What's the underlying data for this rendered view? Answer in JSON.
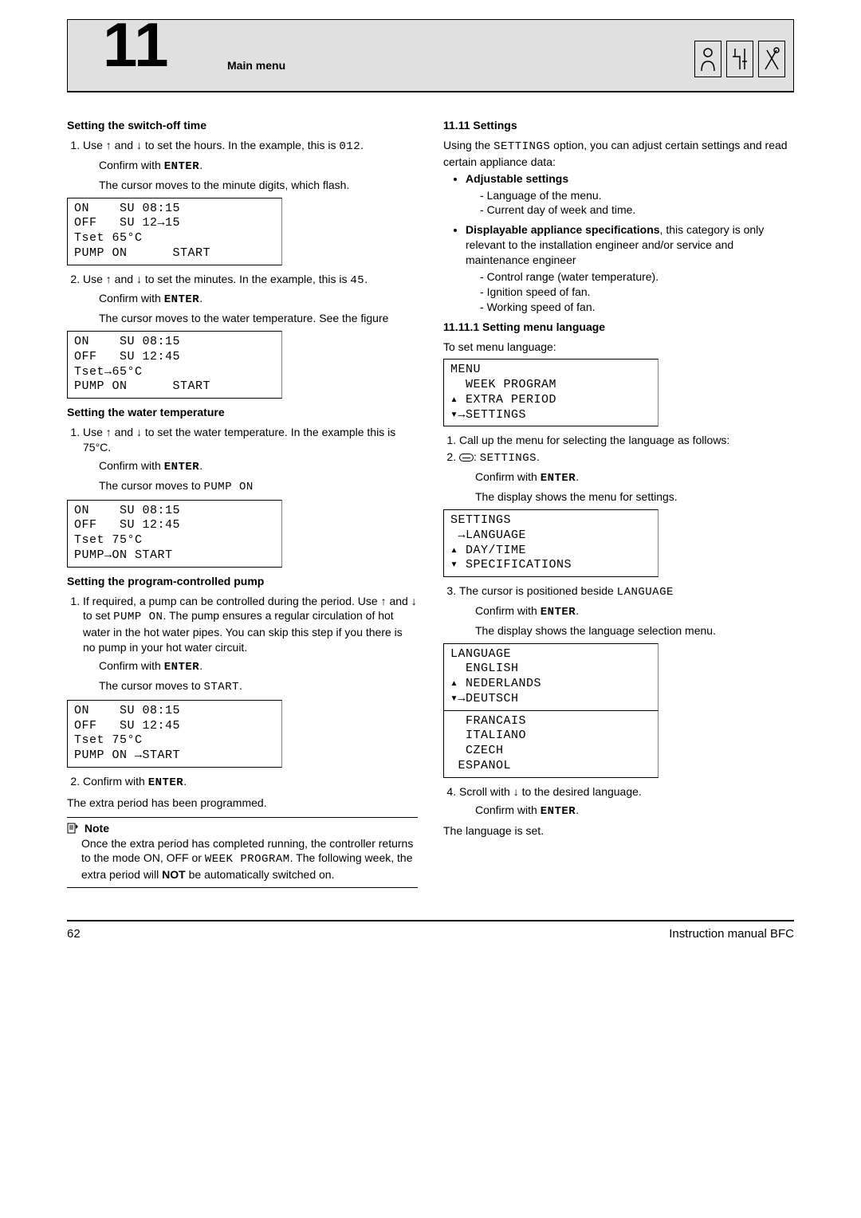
{
  "header": {
    "chapter_number": "11",
    "chapter_title": "Main menu"
  },
  "left": {
    "h_switchoff": "Setting the switch-off time",
    "step1": {
      "num": "1.",
      "text_a": "Use ",
      "text_b": " and ",
      "text_c": " to set the hours. In the example, this is ",
      "val": "012",
      "text_d": ".",
      "confirm": "Confirm with ",
      "enter": "ENTER",
      "confirm_end": ".",
      "cursor": "The cursor moves to the minute digits, which flash."
    },
    "lcd1": "ON    SU 08:15\nOFF   SU 12→15\nTset 65°C\nPUMP ON      START",
    "step2": {
      "num": "2.",
      "text_a": "Use ",
      "text_b": " and ",
      "text_c": " to set the minutes. In the example, this is ",
      "val": "45",
      "text_d": ".",
      "confirm": "Confirm with ",
      "enter": "ENTER",
      "confirm_end": ".",
      "cursor": "The cursor moves to the water temperature. See the figure"
    },
    "lcd2": "ON    SU 08:15\nOFF   SU 12:45\nTset→65°C\nPUMP ON      START",
    "h_watertemp": "Setting the water temperature",
    "wt_step": {
      "num": "1.",
      "text_a": "Use ",
      "text_b": " and ",
      "text_c": " to set the water temperature. In the example this is 75°C.",
      "confirm": "Confirm with ",
      "enter": "ENTER",
      "confirm_end": ".",
      "cursor_a": "The cursor moves to ",
      "cursor_b": "PUMP ON"
    },
    "lcd3": "ON    SU 08:15\nOFF   SU 12:45\nTset 75°C\nPUMP→ON START",
    "h_pump": "Setting the program-controlled pump",
    "pump_step1": {
      "num": "1.",
      "text_a": "If required, a pump can be controlled during the period. Use ",
      "text_b": " and ",
      "text_c": " to set ",
      "pump_on": "PUMP ON",
      "text_d": ". The pump ensures a regular circulation of hot water in the hot water pipes. You can skip this step if you there is no pump in your hot water circuit.",
      "confirm": "Confirm with ",
      "enter": "ENTER",
      "confirm_end": ".",
      "cursor_a": "The cursor moves to ",
      "cursor_b": "START",
      "cursor_c": "."
    },
    "lcd4": "ON    SU 08:15\nOFF   SU 12:45\nTset 75°C\nPUMP ON →START",
    "pump_step2": {
      "num": "2.",
      "confirm": "Confirm with ",
      "enter": "ENTER",
      "confirm_end": "."
    },
    "extra_done": "The extra period has been programmed.",
    "note_label": "Note",
    "note_body_a": "Once the extra period has completed running, the controller returns to the mode ON, OFF or ",
    "note_week": "WEEK PROGRAM",
    "note_body_b": ". The following week, the extra period will ",
    "note_not": "NOT",
    "note_body_c": " be automatically switched on."
  },
  "right": {
    "h_settings": "11.11  Settings",
    "intro_a": "Using the ",
    "intro_b": "SETTINGS",
    "intro_c": " option, you can adjust certain settings and read certain appliance data:",
    "adj_head": "Adjustable settings",
    "adj_items": [
      "Language of the menu.",
      "Current day of week and time."
    ],
    "disp_head": "Displayable appliance specifications",
    "disp_tail": ", this category is only relevant to the installation engineer and/or service and maintenance engineer",
    "disp_items": [
      "Control range (water temperature).",
      "Ignition speed of fan.",
      "Working speed of fan."
    ],
    "h_lang": "11.11.1   Setting menu language",
    "lang_intro": "To set menu language:",
    "lcd_menu": "MENU\n  WEEK PROGRAM\n▴ EXTRA PERIOD\n▾→SETTINGS",
    "l_step1": {
      "num": "1.",
      "text": "Call up the menu for selecting the language as follows:"
    },
    "l_step2": {
      "num": "2.",
      "settings": "SETTINGS",
      "suffix": ".",
      "confirm": "Confirm with ",
      "enter": "ENTER",
      "confirm_end": ".",
      "shows": "The display shows the menu for settings."
    },
    "lcd_settings": "SETTINGS\n →LANGUAGE\n▴ DAY/TIME\n▾ SPECIFICATIONS",
    "l_step3": {
      "num": "3.",
      "text_a": "The cursor is positioned beside ",
      "lang": "LANGUAGE",
      "confirm": "Confirm with ",
      "enter": "ENTER",
      "confirm_end": ".",
      "shows": "The display shows the language selection menu."
    },
    "lcd_lang": "LANGUAGE\n  ENGLISH\n▴ NEDERLANDS\n▾→DEUTSCH",
    "lang_extra": "  FRANCAIS\n  ITALIANO\n  CZECH\n ESPANOL",
    "l_step4": {
      "num": "4.",
      "text_a": "Scroll with ",
      "text_b": " to the desired language.",
      "confirm": "Confirm with ",
      "enter": "ENTER",
      "confirm_end": "."
    },
    "lang_set": "The language is set."
  },
  "footer": {
    "page": "62",
    "manual": "Instruction manual BFC"
  }
}
